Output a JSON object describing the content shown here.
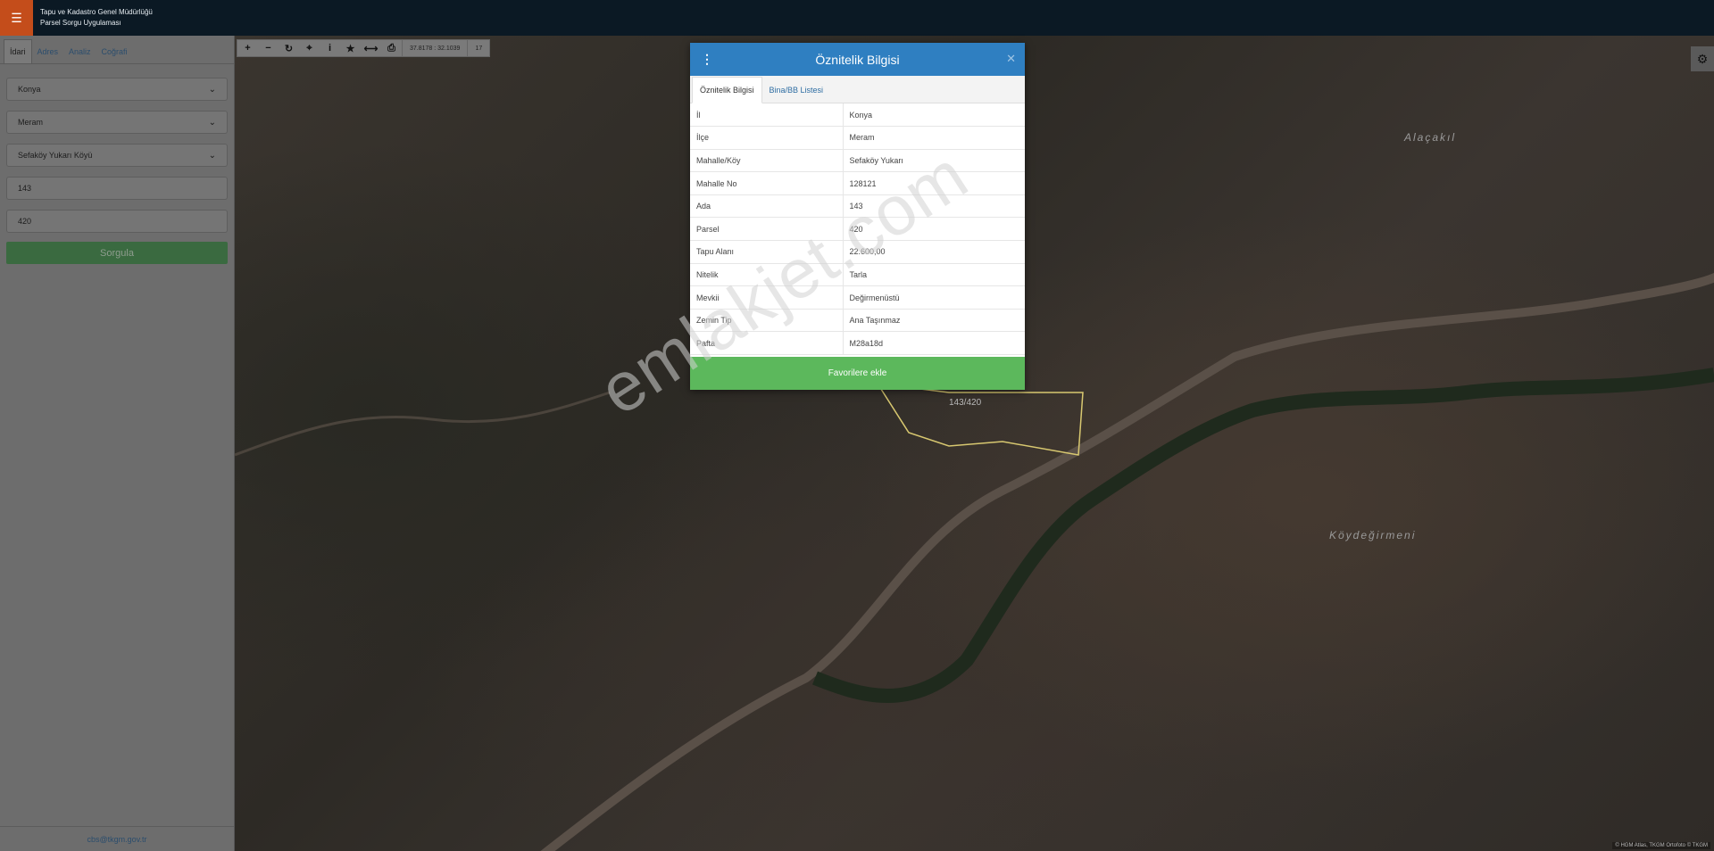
{
  "header": {
    "menu_icon": "hamburger-icon",
    "org_name": "Tapu ve Kadastro Genel Müdürlüğü",
    "app_name": "Parsel Sorgu Uygulaması"
  },
  "sidebar": {
    "tabs": [
      "İdari",
      "Adres",
      "Analiz",
      "Coğrafi"
    ],
    "province": "Konya",
    "district": "Meram",
    "neighborhood": "Sefaköy Yukarı Köyü",
    "block": "143",
    "parcel": "420",
    "query_label": "Sorgula",
    "footer_email": "cbs@tkgm.gov.tr"
  },
  "toolbar": {
    "buttons": [
      "plus-icon",
      "minus-icon",
      "refresh-icon",
      "crosshair-icon",
      "info-icon",
      "star-icon",
      "measure-icon",
      "print-icon"
    ],
    "coords": "37.8178 : 32.1039",
    "zoom": "17"
  },
  "map": {
    "places": [
      "Alaçakıl",
      "Köydeğirmeni"
    ],
    "parcel_label": "143/420",
    "attribution": "© HGM Atlas, TKGM Ortofoto © TKGM",
    "watermark": "emlakjet.com"
  },
  "dialog": {
    "title": "Öznitelik Bilgisi",
    "tabs": [
      "Öznitelik Bilgisi",
      "Bina/BB Listesi"
    ],
    "rows": [
      {
        "key": "İl",
        "value": "Konya"
      },
      {
        "key": "İlçe",
        "value": "Meram"
      },
      {
        "key": "Mahalle/Köy",
        "value": "Sefaköy Yukarı"
      },
      {
        "key": "Mahalle No",
        "value": "128121"
      },
      {
        "key": "Ada",
        "value": "143"
      },
      {
        "key": "Parsel",
        "value": "420"
      },
      {
        "key": "Tapu Alanı",
        "value": "22.600,00"
      },
      {
        "key": "Nitelik",
        "value": "Tarla"
      },
      {
        "key": "Mevkii",
        "value": "Değirmenüstü"
      },
      {
        "key": "Zemin Tip",
        "value": "Ana Taşınmaz"
      },
      {
        "key": "Pafta",
        "value": "M28a18d"
      }
    ],
    "favorite_label": "Favorilere ekle"
  }
}
